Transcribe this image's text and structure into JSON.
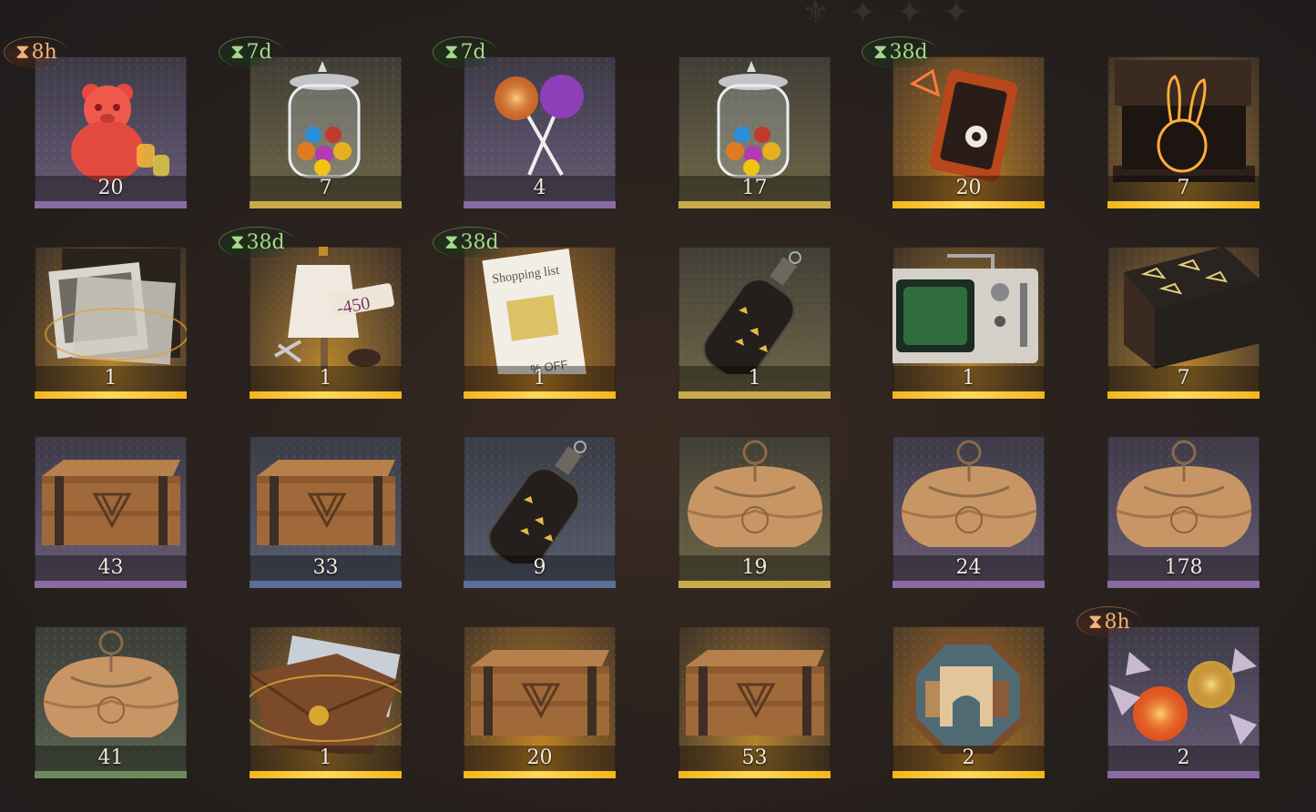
{
  "items": [
    {
      "name": "gummy-bear",
      "count": "20",
      "bg": "purple",
      "strip": "purple",
      "timer": "8h",
      "timer_color": "orange"
    },
    {
      "name": "candy-jar",
      "count": "7",
      "bg": "yellowish",
      "strip": "yellow",
      "timer": "7d",
      "timer_color": "green"
    },
    {
      "name": "lollipops",
      "count": "4",
      "bg": "purple",
      "strip": "purple",
      "timer": "7d",
      "timer_color": "green"
    },
    {
      "name": "candy-jar",
      "count": "17",
      "bg": "yellowish",
      "strip": "yellow",
      "timer": null,
      "timer_color": null
    },
    {
      "name": "orange-device",
      "count": "20",
      "bg": "gold",
      "strip": "gold",
      "timer": "38d",
      "timer_color": "green"
    },
    {
      "name": "rabbit-box",
      "count": "7",
      "bg": "gold2",
      "strip": "gold",
      "timer": null,
      "timer_color": null
    },
    {
      "name": "photo-box",
      "count": "1",
      "bg": "gold2",
      "strip": "gold",
      "timer": null,
      "timer_color": null
    },
    {
      "name": "tailor-mannequin",
      "count": "1",
      "bg": "gold2",
      "strip": "gold",
      "timer": "38d",
      "timer_color": "green"
    },
    {
      "name": "shopping-list",
      "count": "1",
      "bg": "gold",
      "strip": "gold",
      "timer": "38d",
      "timer_color": "green"
    },
    {
      "name": "message-bottle",
      "count": "1",
      "bg": "yellowish",
      "strip": "yellow",
      "timer": null,
      "timer_color": null
    },
    {
      "name": "radio-device",
      "count": "1",
      "bg": "gold2",
      "strip": "gold",
      "timer": null,
      "timer_color": null
    },
    {
      "name": "rune-table",
      "count": "7",
      "bg": "gold2",
      "strip": "gold",
      "timer": null,
      "timer_color": null
    },
    {
      "name": "wooden-crate",
      "count": "43",
      "bg": "purple",
      "strip": "purple",
      "timer": null,
      "timer_color": null
    },
    {
      "name": "wooden-crate",
      "count": "33",
      "bg": "slate",
      "strip": "slate",
      "timer": null,
      "timer_color": null
    },
    {
      "name": "message-bottle",
      "count": "9",
      "bg": "slate",
      "strip": "slate",
      "timer": null,
      "timer_color": null
    },
    {
      "name": "parcel",
      "count": "19",
      "bg": "yellowish",
      "strip": "yellow",
      "timer": null,
      "timer_color": null
    },
    {
      "name": "parcel",
      "count": "24",
      "bg": "purple",
      "strip": "purple",
      "timer": null,
      "timer_color": null
    },
    {
      "name": "parcel",
      "count": "178",
      "bg": "purple",
      "strip": "purple",
      "timer": null,
      "timer_color": null
    },
    {
      "name": "parcel",
      "count": "41",
      "bg": "green",
      "strip": "green",
      "timer": null,
      "timer_color": null
    },
    {
      "name": "envelope",
      "count": "1",
      "bg": "gold2",
      "strip": "gold",
      "timer": null,
      "timer_color": null
    },
    {
      "name": "wooden-crate",
      "count": "20",
      "bg": "gold",
      "strip": "gold",
      "timer": null,
      "timer_color": null
    },
    {
      "name": "wooden-crate",
      "count": "53",
      "bg": "gold2",
      "strip": "gold",
      "timer": null,
      "timer_color": null
    },
    {
      "name": "puzzle-plate",
      "count": "2",
      "bg": "gold",
      "strip": "gold",
      "timer": null,
      "timer_color": null
    },
    {
      "name": "wrapped-candies",
      "count": "2",
      "bg": "purple",
      "strip": "purple",
      "timer": "8h",
      "timer_color": "orange"
    }
  ],
  "hourglass_symbol": "⧗"
}
